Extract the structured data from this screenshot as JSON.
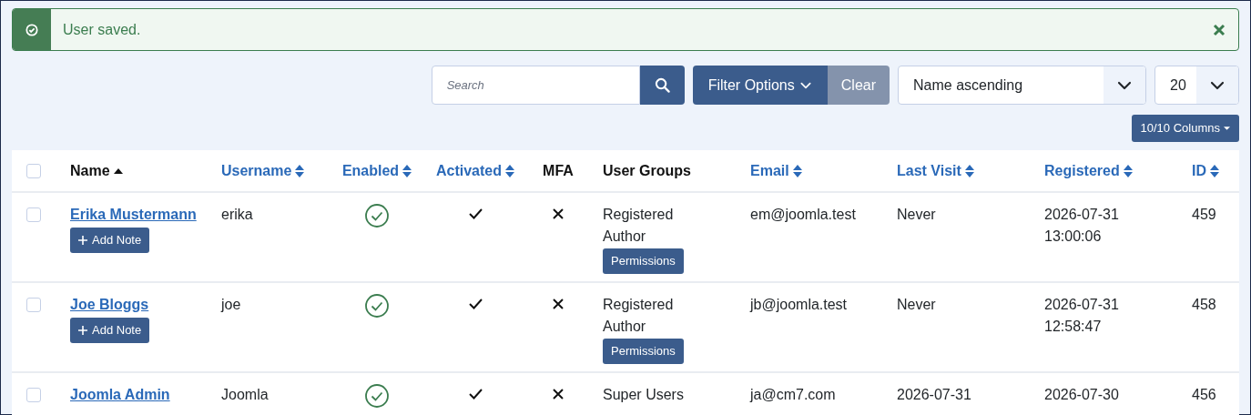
{
  "alert": {
    "message": "User saved.",
    "kind": "success"
  },
  "toolbar": {
    "search": {
      "placeholder": "Search"
    },
    "filter_button": "Filter Options",
    "clear_button": "Clear",
    "ordering": {
      "value": "Name ascending"
    },
    "limit": {
      "value": "20"
    },
    "columns_button": "10/10 Columns"
  },
  "table": {
    "select_all": {
      "checked": false
    },
    "columns": [
      {
        "label": "Name",
        "sortable": true,
        "sorted": true
      },
      {
        "label": "Username",
        "sortable": true,
        "sorted": false
      },
      {
        "label": "Enabled",
        "sortable": true,
        "sorted": false
      },
      {
        "label": "Activated",
        "sortable": true,
        "sorted": false
      },
      {
        "label": "MFA",
        "sortable": false,
        "sorted": false
      },
      {
        "label": "User Groups",
        "sortable": false,
        "sorted": false
      },
      {
        "label": "Email",
        "sortable": true,
        "sorted": false
      },
      {
        "label": "Last Visit",
        "sortable": true,
        "sorted": false
      },
      {
        "label": "Registered",
        "sortable": true,
        "sorted": false
      },
      {
        "label": "ID",
        "sortable": true,
        "sorted": false
      }
    ],
    "rows": [
      {
        "checked": false,
        "name": "Erika Mustermann",
        "add_note": "Add Note",
        "username": "erika",
        "enabled": true,
        "activated": true,
        "mfa": false,
        "groups": [
          "Registered",
          "Author"
        ],
        "permissions": "Permissions",
        "email": "em@joomla.test",
        "last_visit": "Never",
        "registered": "2026-07-31 13:00:06",
        "id": "459"
      },
      {
        "checked": false,
        "name": "Joe Bloggs",
        "add_note": "Add Note",
        "username": "joe",
        "enabled": true,
        "activated": true,
        "mfa": false,
        "groups": [
          "Registered",
          "Author"
        ],
        "permissions": "Permissions",
        "email": "jb@joomla.test",
        "last_visit": "Never",
        "registered": "2026-07-31 12:58:47",
        "id": "458"
      },
      {
        "checked": false,
        "name": "Joomla Admin",
        "username": "Joomla",
        "enabled": true,
        "activated": true,
        "mfa": false,
        "groups": [
          "Super Users"
        ],
        "email": "ja@cm7.com",
        "last_visit": "2026-07-31",
        "registered": "2026-07-30",
        "id": "456"
      }
    ]
  }
}
